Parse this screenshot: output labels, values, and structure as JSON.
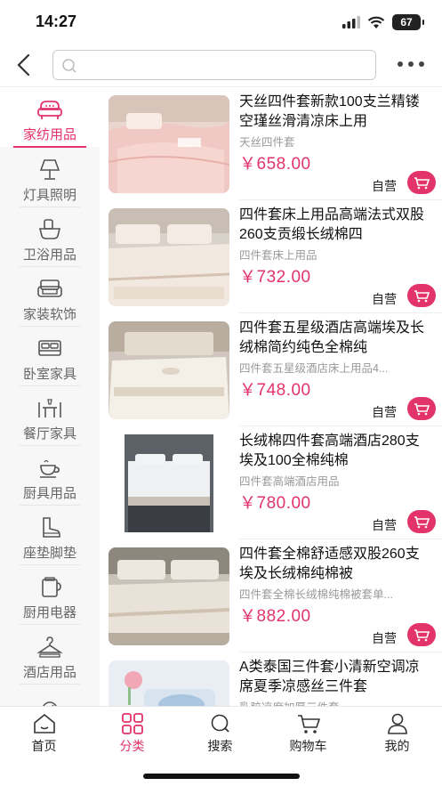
{
  "status_bar": {
    "time": "14:27",
    "battery": "67"
  },
  "search": {
    "placeholder": "",
    "value": ""
  },
  "sidebar": {
    "items": [
      {
        "label": "家纺用品",
        "icon": "sofa-icon",
        "active": true
      },
      {
        "label": "灯具照明",
        "icon": "lamp-icon"
      },
      {
        "label": "卫浴用品",
        "icon": "bathroom-icon"
      },
      {
        "label": "家装软饰",
        "icon": "couch-icon"
      },
      {
        "label": "卧室家具",
        "icon": "bed-icon"
      },
      {
        "label": "餐厅家具",
        "icon": "dining-icon"
      },
      {
        "label": "厨具用品",
        "icon": "teapot-icon"
      },
      {
        "label": "座垫脚垫",
        "icon": "boot-icon"
      },
      {
        "label": "厨用电器",
        "icon": "appliance-icon"
      },
      {
        "label": "酒店用品",
        "icon": "hanger-icon"
      },
      {
        "label": "",
        "icon": "partial-icon"
      }
    ]
  },
  "products": [
    {
      "title": "天丝四件套新款100支兰精镂空瑾丝滑清凉床上用",
      "subtitle": "天丝四件套",
      "price": "￥658.00",
      "tag": "自营"
    },
    {
      "title": "四件套床上用品高端法式双股260支贡缎长绒棉四",
      "subtitle": "四件套床上用品",
      "price": "￥732.00",
      "tag": "自营"
    },
    {
      "title": "四件套五星级酒店高端埃及长绒棉简约纯色全棉纯",
      "subtitle": "四件套五星级酒店床上用品4...",
      "price": "￥748.00",
      "tag": "自营"
    },
    {
      "title": "长绒棉四件套高端酒店280支埃及100全棉纯棉",
      "subtitle": "四件套高端酒店用品",
      "price": "￥780.00",
      "tag": "自营"
    },
    {
      "title": "四件套全棉舒适感双股260支埃及长绒棉纯棉被",
      "subtitle": "四件套全棉长绒棉纯棉被套单...",
      "price": "￥882.00",
      "tag": "自营"
    },
    {
      "title": "A类泰国三件套小清新空调凉席夏季凉感丝三件套",
      "subtitle": "乳胶凉席加厚三件套",
      "price": "",
      "tag": ""
    }
  ],
  "tabbar": {
    "items": [
      {
        "label": "首页",
        "icon": "home-icon"
      },
      {
        "label": "分类",
        "icon": "grid-icon",
        "active": true
      },
      {
        "label": "搜索",
        "icon": "search-icon"
      },
      {
        "label": "购物车",
        "icon": "cart-icon"
      },
      {
        "label": "我的",
        "icon": "user-icon"
      }
    ]
  },
  "colors": {
    "accent": "#e2336a",
    "sidebar_bg": "#f7f7f7"
  }
}
